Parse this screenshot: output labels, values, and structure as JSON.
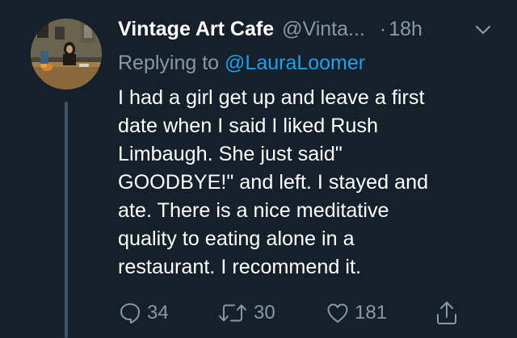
{
  "tweet": {
    "display_name": "Vintage Art Cafe",
    "handle": "@Vinta...",
    "separator": "·",
    "time": "18h",
    "reply_prefix": "Replying to ",
    "reply_to": "@LauraLoomer",
    "body_lines": [
      "I had a girl get up and leave a first",
      "date when I said I liked Rush",
      "Limbaugh. She just said\"",
      "GOODBYE!\" and left. I stayed and",
      "ate. There is a nice meditative",
      "quality to eating alone in a",
      "restaurant. I recommend it."
    ]
  },
  "actions": {
    "reply_count": "34",
    "retweet_count": "30",
    "like_count": "181"
  },
  "icons": {
    "caret": "chevron-down-icon",
    "reply": "comment-icon",
    "retweet": "retweet-icon",
    "like": "heart-icon",
    "share": "share-icon"
  },
  "colors": {
    "background": "#15202b",
    "text_primary": "#ffffff",
    "text_secondary": "#8899a6",
    "link": "#1da1f2",
    "thread_line": "#3d5466"
  }
}
